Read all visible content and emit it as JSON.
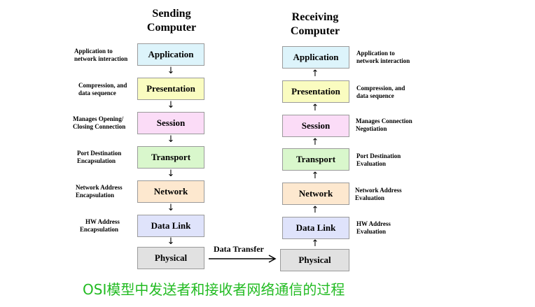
{
  "sending": {
    "title_line1": "Sending",
    "title_line2": "Computer",
    "layers": [
      {
        "label": "Application",
        "note": [
          "Application to",
          "network interaction"
        ]
      },
      {
        "label": "Presentation",
        "note": [
          "Compression, and",
          "data sequence"
        ]
      },
      {
        "label": "Session",
        "note": [
          "Manages Opening/",
          "Closing Connection"
        ]
      },
      {
        "label": "Transport",
        "note": [
          "Port Destination",
          "Encapsulation"
        ]
      },
      {
        "label": "Network",
        "note": [
          "Network Address",
          "Encapsulation"
        ]
      },
      {
        "label": "Data Link",
        "note": [
          "HW Address",
          "Encapsulation"
        ]
      },
      {
        "label": "Physical",
        "note": []
      }
    ]
  },
  "receiving": {
    "title_line1": "Receiving",
    "title_line2": "Computer",
    "layers": [
      {
        "label": "Application",
        "note": [
          "Application to",
          "network interaction"
        ]
      },
      {
        "label": "Presentation",
        "note": [
          "Compression, and",
          "data sequence"
        ]
      },
      {
        "label": "Session",
        "note": [
          "Manages Connection",
          "Negotiation"
        ]
      },
      {
        "label": "Transport",
        "note": [
          "Port Destination",
          "Evaluation"
        ]
      },
      {
        "label": "Network",
        "note": [
          "Network Address",
          "Evaluation"
        ]
      },
      {
        "label": "Data Link",
        "note": [
          "HW Address",
          "Evaluation"
        ]
      },
      {
        "label": "Physical",
        "note": []
      }
    ]
  },
  "arrows": {
    "down": "↓",
    "up": "↑"
  },
  "transfer_label": "Data Transfer",
  "caption": "OSI模型中发送者和接收者网络通信的过程",
  "colors": {
    "application": "#ddf4fb",
    "presentation": "#fafcc0",
    "session": "#fbdcf7",
    "transport": "#d9f7cc",
    "network": "#fde8cf",
    "data_link": "#dfe3fb",
    "physical": "#e1e1e1",
    "caption": "#22bb22"
  }
}
